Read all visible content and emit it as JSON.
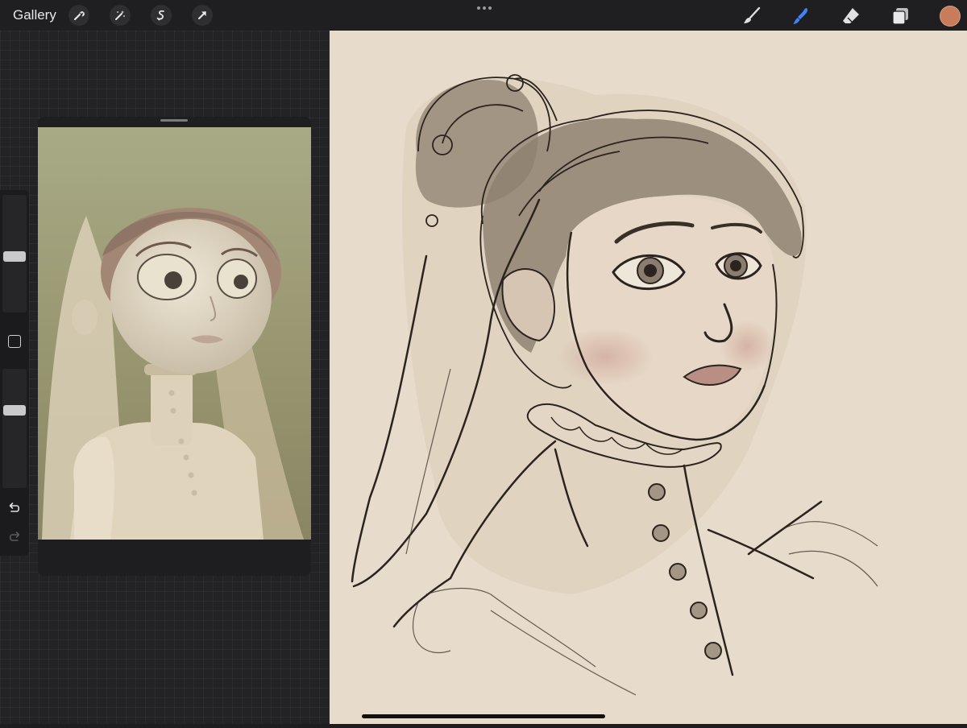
{
  "topbar": {
    "gallery_label": "Gallery",
    "left_tools": [
      "wrench-icon",
      "magic-wand-icon",
      "selection-icon",
      "transform-arrow-icon"
    ],
    "more_icon": "more-dots-icon",
    "right_tools": [
      "brush-icon",
      "smudge-icon",
      "eraser-icon",
      "layers-icon"
    ],
    "active_tool": "smudge-icon",
    "colors": {
      "active_tool": "#3f83f8",
      "current_color": "#c87d5a"
    }
  },
  "sidebar": {
    "brush_size": 0.5,
    "opacity": 0.66
  }
}
